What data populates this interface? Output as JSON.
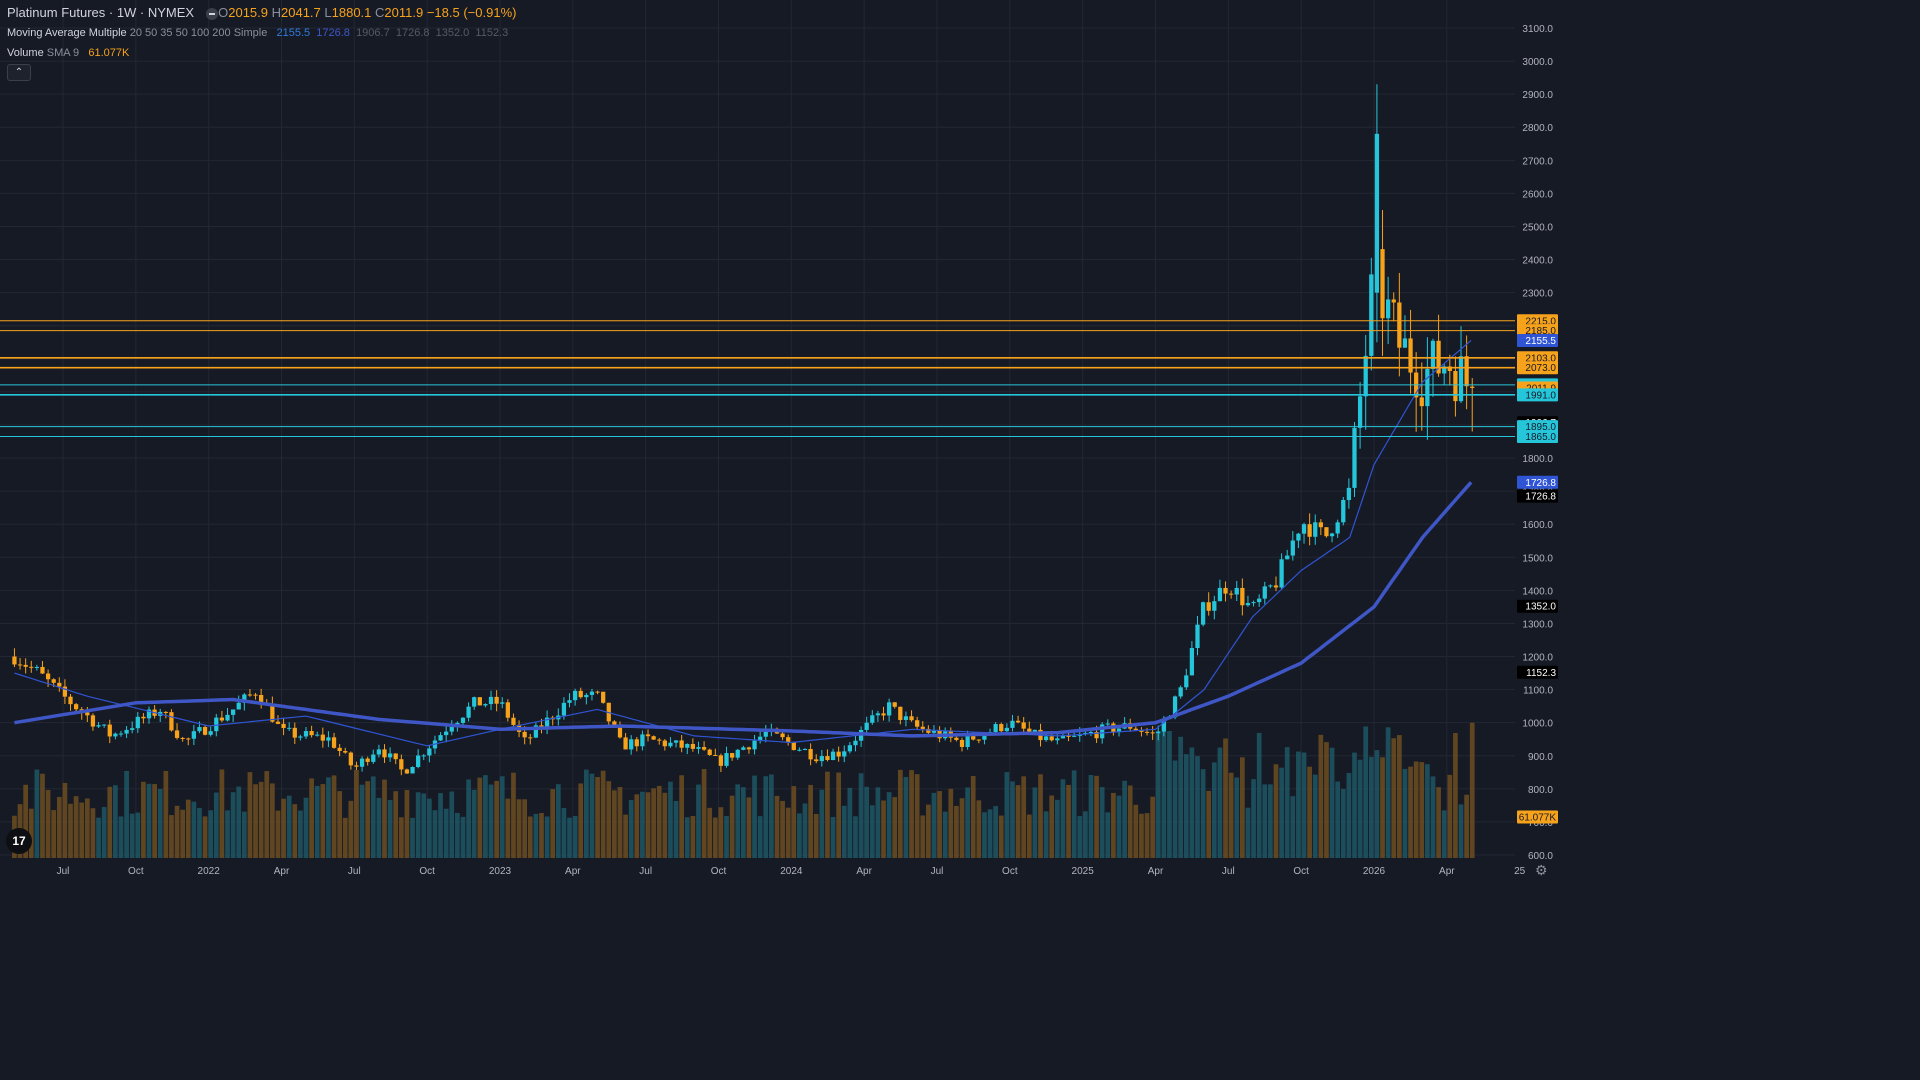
{
  "header": {
    "symbol": "Platinum Futures · 1W · NYMEX",
    "o_label": "O",
    "o_value": "2015.9",
    "h_label": "H",
    "h_value": "2041.7",
    "l_label": "L",
    "l_value": "1880.1",
    "c_label": "C",
    "c_value": "2011.9",
    "change": "−18.5 (−0.91%)"
  },
  "ma_legend": {
    "title": "Moving Average Multiple",
    "params": "20 50 35 50 100 200 Simple",
    "values": [
      "2155.5",
      "1726.8",
      "1906.7",
      "1726.8",
      "1352.0",
      "1152.3"
    ]
  },
  "volume_legend": {
    "title": "Volume",
    "params": "SMA 9",
    "value": "61.077K"
  },
  "colors": {
    "background": "#161a25",
    "up": "#26c6da",
    "down": "#f7a21b",
    "ma_fast": "#2f55d4",
    "ma_slow": "#3f57c6",
    "grid": "#232733"
  },
  "icons": {
    "collapse": "chevron-up-icon",
    "logo": "tradingview-logo",
    "settings": "gear-icon",
    "eye": "eye-icon"
  },
  "collapse_glyph": "⌃",
  "logo_text": "17",
  "settings_glyph": "⚙",
  "chart_data": {
    "type": "candlestick",
    "title": "Platinum Futures · 1W · NYMEX",
    "ylim": [
      600,
      3130
    ],
    "y_ticks": [
      600,
      700,
      800,
      900,
      1000,
      1100,
      1200,
      1300,
      1400,
      1500,
      1600,
      1700,
      1800,
      1900,
      2000,
      2100,
      2200,
      2300,
      2400,
      2500,
      2600,
      2700,
      2800,
      2900,
      3000,
      3100
    ],
    "y_tick_labels": [
      "600.0",
      "700.0",
      "800.0",
      "900.0",
      "1000.0",
      "1100.0",
      "1200.0",
      "1300.0",
      "1400.0",
      "1500.0",
      "1600.0",
      "1700.0",
      "1800.0",
      "1900.0",
      "2000.0",
      "2100.0",
      "2200.0",
      "2300.0",
      "2400.0",
      "2500.0",
      "2600.0",
      "2700.0",
      "2800.0",
      "2900.0",
      "3000.0",
      "3100.0"
    ],
    "x_labels": [
      "Jul",
      "Oct",
      "2022",
      "Apr",
      "Jul",
      "Oct",
      "2023",
      "Apr",
      "Jul",
      "Oct",
      "2024",
      "Apr",
      "Jul",
      "Oct",
      "2025",
      "Apr",
      "Jul",
      "Oct",
      "2026",
      "Apr",
      "25"
    ],
    "x_label_positions": [
      "2021-07",
      "2021-10",
      "2022-01",
      "2022-04",
      "2022-07",
      "2022-10",
      "2023-01",
      "2023-04",
      "2023-07",
      "2023-10",
      "2024-01",
      "2024-04",
      "2024-07",
      "2024-10",
      "2025-01",
      "2025-04",
      "2025-07",
      "2025-10",
      "2026-01",
      "2026-04",
      "2026-07"
    ],
    "price_anchors": [
      {
        "date": "2021-05",
        "close": 1200
      },
      {
        "date": "2021-06",
        "close": 1150
      },
      {
        "date": "2021-07",
        "close": 1080
      },
      {
        "date": "2021-09",
        "close": 960
      },
      {
        "date": "2021-11",
        "close": 1040
      },
      {
        "date": "2021-12",
        "close": 940
      },
      {
        "date": "2022-02",
        "close": 1040
      },
      {
        "date": "2022-03",
        "close": 1100
      },
      {
        "date": "2022-04",
        "close": 970
      },
      {
        "date": "2022-06",
        "close": 950
      },
      {
        "date": "2022-07",
        "close": 860
      },
      {
        "date": "2022-08",
        "close": 930
      },
      {
        "date": "2022-09",
        "close": 850
      },
      {
        "date": "2022-11",
        "close": 1000
      },
      {
        "date": "2022-12",
        "close": 1060
      },
      {
        "date": "2023-01",
        "close": 1060
      },
      {
        "date": "2023-02",
        "close": 940
      },
      {
        "date": "2023-04",
        "close": 1080
      },
      {
        "date": "2023-05",
        "close": 1080
      },
      {
        "date": "2023-06",
        "close": 930
      },
      {
        "date": "2023-07",
        "close": 950
      },
      {
        "date": "2023-09",
        "close": 920
      },
      {
        "date": "2023-10",
        "close": 880
      },
      {
        "date": "2023-12",
        "close": 970
      },
      {
        "date": "2024-02",
        "close": 900
      },
      {
        "date": "2024-03",
        "close": 910
      },
      {
        "date": "2024-05",
        "close": 1050
      },
      {
        "date": "2024-06",
        "close": 990
      },
      {
        "date": "2024-08",
        "close": 940
      },
      {
        "date": "2024-10",
        "close": 1000
      },
      {
        "date": "2024-11",
        "close": 960
      },
      {
        "date": "2024-12",
        "close": 940
      },
      {
        "date": "2025-02",
        "close": 980
      },
      {
        "date": "2025-03",
        "close": 990
      },
      {
        "date": "2025-04",
        "close": 960
      },
      {
        "date": "2025-05",
        "close": 1090
      },
      {
        "date": "2025-06",
        "close": 1350
      },
      {
        "date": "2025-07",
        "close": 1420
      },
      {
        "date": "2025-08",
        "close": 1340
      },
      {
        "date": "2025-09",
        "close": 1430
      },
      {
        "date": "2025-10",
        "close": 1610
      },
      {
        "date": "2025-11",
        "close": 1560
      },
      {
        "date": "2025-12",
        "close": 1700
      },
      {
        "date": "2026-01",
        "close": 2350
      },
      {
        "date": "2026-02",
        "close": 2150
      },
      {
        "date": "2026-03",
        "close": 2050
      },
      {
        "date": "2026-04",
        "close": 2100
      },
      {
        "date": "2026-05",
        "close": 2011.9
      }
    ],
    "spike": {
      "date": "2026-01",
      "high": 2930,
      "close": 2780
    },
    "last_candle": {
      "open": 2015.9,
      "high": 2041.7,
      "low": 1880.1,
      "close": 2011.9
    },
    "moving_averages": [
      {
        "name": "MA fast",
        "anchors": [
          {
            "date": "2021-05",
            "value": 1150
          },
          {
            "date": "2021-08",
            "value": 1080
          },
          {
            "date": "2022-01",
            "value": 990
          },
          {
            "date": "2022-05",
            "value": 1020
          },
          {
            "date": "2022-10",
            "value": 930
          },
          {
            "date": "2023-01",
            "value": 980
          },
          {
            "date": "2023-05",
            "value": 1040
          },
          {
            "date": "2023-09",
            "value": 960
          },
          {
            "date": "2024-01",
            "value": 940
          },
          {
            "date": "2024-06",
            "value": 980
          },
          {
            "date": "2024-12",
            "value": 960
          },
          {
            "date": "2025-04",
            "value": 980
          },
          {
            "date": "2025-06",
            "value": 1100
          },
          {
            "date": "2025-08",
            "value": 1320
          },
          {
            "date": "2025-10",
            "value": 1460
          },
          {
            "date": "2025-12",
            "value": 1560
          },
          {
            "date": "2026-01",
            "value": 1780
          },
          {
            "date": "2026-03",
            "value": 2030
          },
          {
            "date": "2026-05",
            "value": 2155.5
          }
        ]
      },
      {
        "name": "MA slow",
        "anchors": [
          {
            "date": "2021-05",
            "value": 1000
          },
          {
            "date": "2021-10",
            "value": 1060
          },
          {
            "date": "2022-02",
            "value": 1070
          },
          {
            "date": "2022-08",
            "value": 1010
          },
          {
            "date": "2023-01",
            "value": 980
          },
          {
            "date": "2023-06",
            "value": 990
          },
          {
            "date": "2024-01",
            "value": 975
          },
          {
            "date": "2024-06",
            "value": 960
          },
          {
            "date": "2024-12",
            "value": 970
          },
          {
            "date": "2025-04",
            "value": 1000
          },
          {
            "date": "2025-07",
            "value": 1080
          },
          {
            "date": "2025-10",
            "value": 1180
          },
          {
            "date": "2026-01",
            "value": 1350
          },
          {
            "date": "2026-03",
            "value": 1560
          },
          {
            "date": "2026-05",
            "value": 1726.8
          }
        ]
      }
    ],
    "horizontal_lines": [
      {
        "value": 2215.0,
        "color": "#f7a21b",
        "width": 1
      },
      {
        "value": 2185.0,
        "color": "#f7a21b",
        "width": 1
      },
      {
        "value": 2103.0,
        "color": "#f7a21b",
        "width": 1.6
      },
      {
        "value": 2073.0,
        "color": "#f7a21b",
        "width": 1.6
      },
      {
        "value": 2021.0,
        "color": "#26c6da",
        "width": 1
      },
      {
        "value": 1991.0,
        "color": "#26c6da",
        "width": 1.6
      },
      {
        "value": 1895.0,
        "color": "#26c6da",
        "width": 1
      },
      {
        "value": 1865.0,
        "color": "#26c6da",
        "width": 1
      }
    ],
    "price_labels": [
      {
        "text": "2215.0",
        "value": 2215.0,
        "bg": "#f7a21b",
        "fg": "#161a25"
      },
      {
        "text": "2185.0",
        "value": 2185.0,
        "bg": "#f7a21b",
        "fg": "#161a25"
      },
      {
        "text": "2155.5",
        "value": 2155.5,
        "bg": "#2f55d4",
        "fg": "#ffffff"
      },
      {
        "text": "2103.0",
        "value": 2103.0,
        "bg": "#f7a21b",
        "fg": "#161a25"
      },
      {
        "text": "2073.0",
        "value": 2073.0,
        "bg": "#f7a21b",
        "fg": "#161a25"
      },
      {
        "text": "2021.0",
        "value": 2021.0,
        "bg": "#26c6da",
        "fg": "#161a25"
      },
      {
        "text": "2011.9",
        "value": 2011.9,
        "bg": "#f7a21b",
        "fg": "#161a25"
      },
      {
        "text": "1991.0",
        "value": 1991.0,
        "bg": "#26c6da",
        "fg": "#161a25"
      },
      {
        "text": "1906.7",
        "value": 1906.7,
        "bg": "#000000",
        "fg": "#ffffff"
      },
      {
        "text": "1895.0",
        "value": 1895.0,
        "bg": "#26c6da",
        "fg": "#161a25"
      },
      {
        "text": "1865.0",
        "value": 1865.0,
        "bg": "#26c6da",
        "fg": "#161a25"
      },
      {
        "text": "1726.8",
        "value": 1726.8,
        "bg": "#2f55d4",
        "fg": "#ffffff"
      },
      {
        "text": "1726.8",
        "value": 1685,
        "bg": "#000000",
        "fg": "#ffffff"
      },
      {
        "text": "1352.0",
        "value": 1352.0,
        "bg": "#000000",
        "fg": "#ffffff"
      },
      {
        "text": "1152.3",
        "value": 1152.3,
        "bg": "#000000",
        "fg": "#ffffff"
      },
      {
        "text": "61.077K",
        "value": 715,
        "bg": "#f7a21b",
        "fg": "#161a25"
      }
    ],
    "volume": {
      "sma_value": "61.077K",
      "unit": "K"
    }
  }
}
